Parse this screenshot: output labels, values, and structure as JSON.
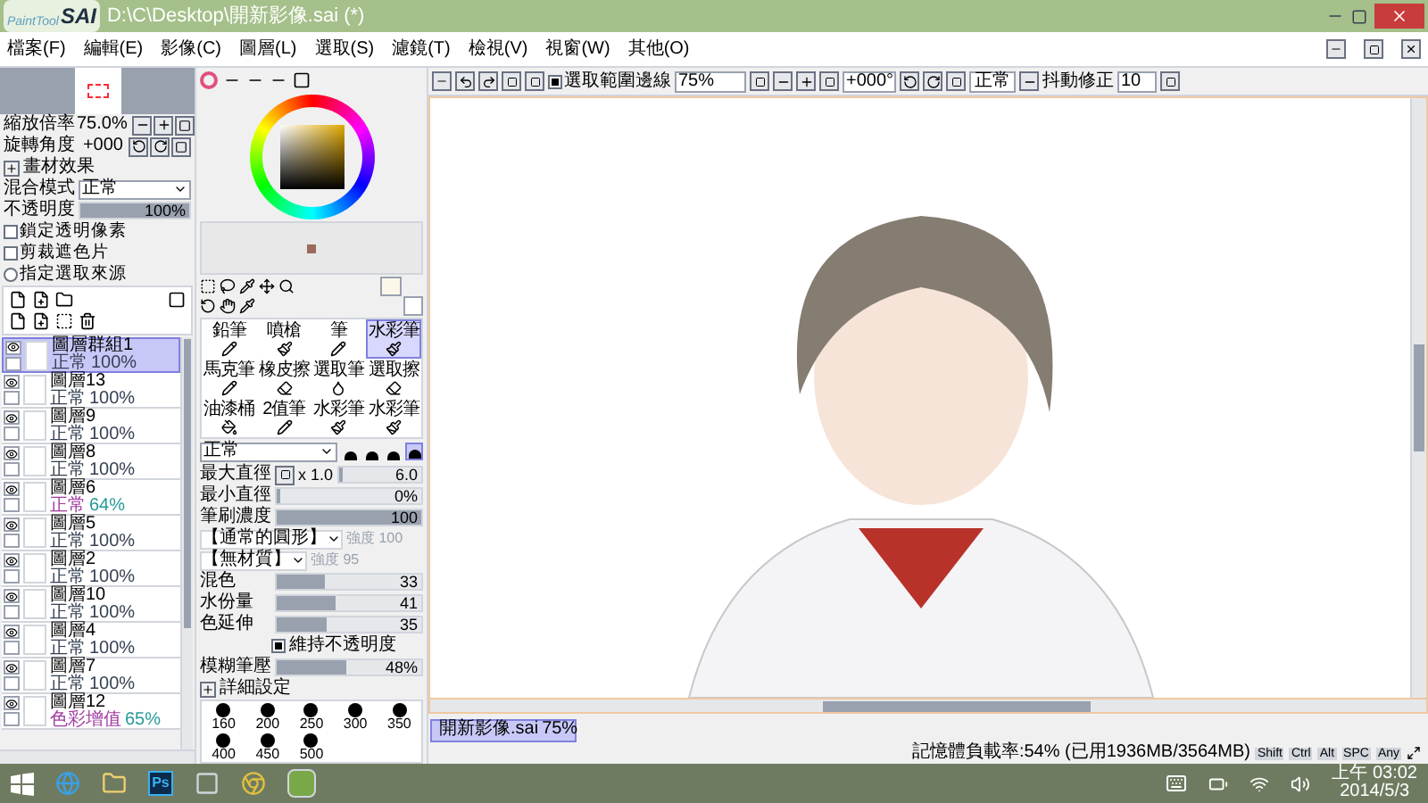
{
  "window": {
    "logo_small": "PaintTool",
    "logo": "SAI",
    "title": "D:\\C\\Desktop\\開新影像.sai (*)"
  },
  "menu": [
    "檔案(F)",
    "編輯(E)",
    "影像(C)",
    "圖層(L)",
    "選取(S)",
    "濾鏡(T)",
    "檢視(V)",
    "視窗(W)",
    "其他(O)"
  ],
  "navigator": {
    "zoom_label": "縮放倍率",
    "zoom_value": "75.0%",
    "rotate_label": "旋轉角度",
    "rotate_value": "+000"
  },
  "layer_panel": {
    "effects_label": "畫材效果",
    "blend_label": "混合模式",
    "blend_value": "正常",
    "opacity": {
      "label": "不透明度",
      "reading": "100%",
      "level": 1
    },
    "options": [
      {
        "kind": "checkbox",
        "label": "鎖定透明像素",
        "checked": false
      },
      {
        "kind": "checkbox",
        "label": "剪裁遮色片",
        "checked": false
      },
      {
        "kind": "radio",
        "label": "指定選取來源",
        "checked": false
      }
    ],
    "layers": [
      {
        "name": "圖層群組1",
        "mode": "正常",
        "opacity": "100%",
        "visible": true,
        "selected": true,
        "highlight": false
      },
      {
        "name": "圖層13",
        "mode": "正常",
        "opacity": "100%",
        "visible": true,
        "selected": false,
        "highlight": false
      },
      {
        "name": "圖層9",
        "mode": "正常",
        "opacity": "100%",
        "visible": true,
        "selected": false,
        "highlight": false
      },
      {
        "name": "圖層8",
        "mode": "正常",
        "opacity": "100%",
        "visible": true,
        "selected": false,
        "highlight": false
      },
      {
        "name": "圖層6",
        "mode": "正常",
        "opacity": "64%",
        "visible": true,
        "selected": false,
        "highlight": true
      },
      {
        "name": "圖層5",
        "mode": "正常",
        "opacity": "100%",
        "visible": true,
        "selected": false,
        "highlight": false
      },
      {
        "name": "圖層2",
        "mode": "正常",
        "opacity": "100%",
        "visible": true,
        "selected": false,
        "highlight": false
      },
      {
        "name": "圖層10",
        "mode": "正常",
        "opacity": "100%",
        "visible": true,
        "selected": false,
        "highlight": false
      },
      {
        "name": "圖層4",
        "mode": "正常",
        "opacity": "100%",
        "visible": true,
        "selected": false,
        "highlight": false
      },
      {
        "name": "圖層7",
        "mode": "正常",
        "opacity": "100%",
        "visible": true,
        "selected": false,
        "highlight": false
      },
      {
        "name": "圖層12",
        "mode": "色彩增值",
        "opacity": "65%",
        "visible": true,
        "selected": false,
        "highlight": true
      }
    ]
  },
  "tools": [
    {
      "name": "鉛筆",
      "selected": false
    },
    {
      "name": "噴槍",
      "selected": false
    },
    {
      "name": "筆",
      "selected": false
    },
    {
      "name": "水彩筆",
      "selected": true
    },
    {
      "name": "馬克筆",
      "selected": false
    },
    {
      "name": "橡皮擦",
      "selected": false
    },
    {
      "name": "選取筆",
      "selected": false
    },
    {
      "name": "選取擦",
      "selected": false
    },
    {
      "name": "油漆桶",
      "selected": false
    },
    {
      "name": "2值筆",
      "selected": false
    },
    {
      "name": "水彩筆",
      "selected": false
    },
    {
      "name": "水彩筆",
      "selected": false
    }
  ],
  "brush": {
    "mode": "正常",
    "shapes": [
      {
        "selected": false
      },
      {
        "selected": false
      },
      {
        "selected": false
      },
      {
        "selected": true
      }
    ],
    "settings": [
      {
        "kind": "size",
        "label": "最大直徑",
        "multiplier": "x 1.0",
        "reading": "6.0",
        "level": 0.05
      },
      {
        "kind": "slider",
        "label": "最小直徑",
        "reading": "0%",
        "level": 0
      },
      {
        "kind": "slider",
        "label": "筆刷濃度",
        "reading": "100",
        "level": 1
      },
      {
        "kind": "dropdown",
        "value": "【通常的圓形】",
        "strength": "強度 100",
        "disabled": true
      },
      {
        "kind": "dropdown",
        "value": "【無材質】",
        "strength": "強度 95",
        "disabled": true
      },
      {
        "kind": "slider",
        "label": "混色",
        "reading": "33",
        "level": 0.33
      },
      {
        "kind": "slider",
        "label": "水份量",
        "reading": "41",
        "level": 0.41
      },
      {
        "kind": "slider",
        "label": "色延伸",
        "reading": "35",
        "level": 0.35
      },
      {
        "kind": "checkbox",
        "label": "維持不透明度",
        "checked": true
      },
      {
        "kind": "slider",
        "label": "模糊筆壓",
        "reading": "48%",
        "level": 0.48
      }
    ],
    "detail_label": "詳細設定",
    "sizes": [
      "160",
      "200",
      "250",
      "300",
      "350",
      "400",
      "450",
      "500"
    ]
  },
  "toolbar": {
    "selection_edge": {
      "label": "選取範圍邊線",
      "checked": true
    },
    "zoom": "75%",
    "angle": "+000°",
    "mode": "正常",
    "stabilizer_label": "抖動修正",
    "stabilizer": "10"
  },
  "canvas_tab": {
    "name": "開新影像.sai",
    "zoom": "75%",
    "selected": true
  },
  "status_bar": {
    "memory": "記憶體負載率:54% (已用1936MB/3564MB)",
    "keys": [
      "Shift",
      "Ctrl",
      "Alt",
      "SPC",
      "Any"
    ]
  },
  "taskbar": {
    "photoshop_label": "Ps",
    "time": "上午 03:02",
    "date": "2014/5/3"
  }
}
